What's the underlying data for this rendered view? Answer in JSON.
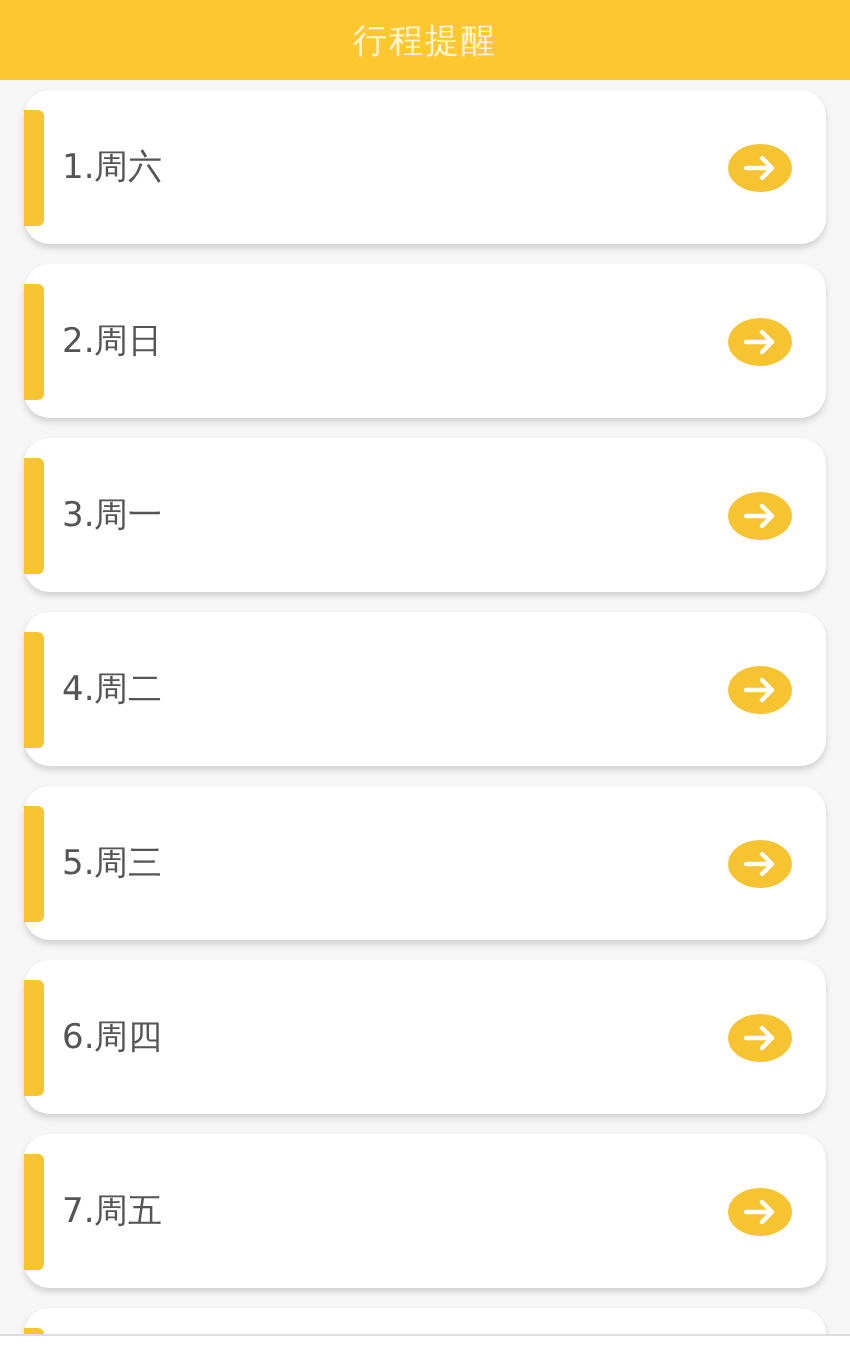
{
  "header": {
    "title": "行程提醒"
  },
  "items": [
    {
      "kind": "entry",
      "label": "1.周六"
    },
    {
      "kind": "entry",
      "label": "2.周日"
    },
    {
      "kind": "entry",
      "label": "3.周一"
    },
    {
      "kind": "entry",
      "label": "4.周二"
    },
    {
      "kind": "entry",
      "label": "5.周三"
    },
    {
      "kind": "entry",
      "label": "6.周四"
    },
    {
      "kind": "entry",
      "label": "7.周五"
    },
    {
      "kind": "partial"
    }
  ]
}
